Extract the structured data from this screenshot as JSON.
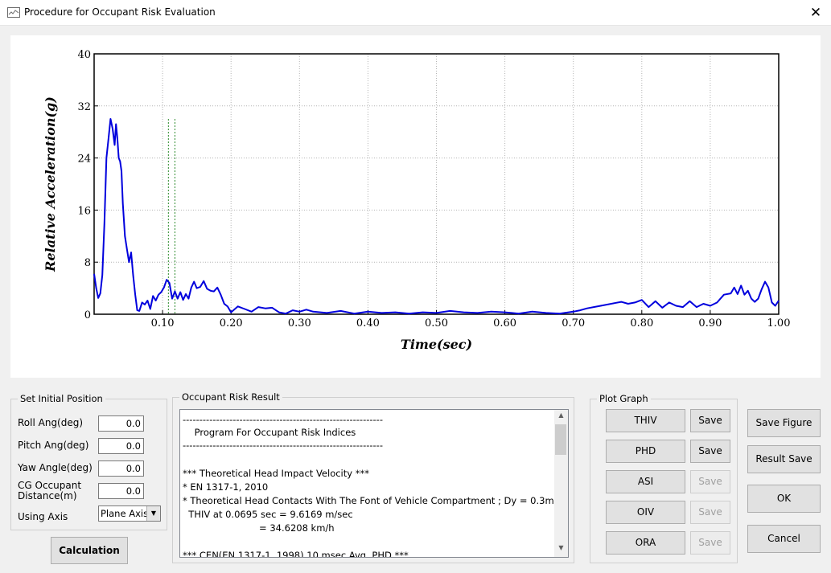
{
  "window": {
    "title": "Procedure for Occupant Risk Evaluation",
    "close_symbol": "✕"
  },
  "chart_data": {
    "type": "line",
    "xlabel": "Time(sec)",
    "ylabel": "Relative Acceleration(g)",
    "xlim": [
      0,
      1.0
    ],
    "ylim": [
      0,
      40
    ],
    "x_ticks": [
      "0.10",
      "0.20",
      "0.30",
      "0.40",
      "0.50",
      "0.60",
      "0.70",
      "0.80",
      "0.90",
      "1.00"
    ],
    "y_ticks": [
      "0",
      "8",
      "16",
      "24",
      "32",
      "40"
    ],
    "grid": true,
    "series_color": "#0000dd",
    "marker_lines_color": "#2e8b2e",
    "marker_lines_x": [
      0.1085,
      0.118
    ],
    "marker_lines_top": 30,
    "series": [
      {
        "x": [
          0,
          0.003,
          0.006,
          0.009,
          0.012,
          0.015,
          0.018,
          0.021,
          0.024,
          0.027,
          0.03,
          0.032,
          0.034,
          0.036,
          0.038,
          0.04,
          0.042,
          0.045,
          0.048,
          0.051,
          0.054,
          0.057,
          0.06,
          0.063,
          0.066,
          0.07,
          0.074,
          0.078,
          0.082,
          0.086,
          0.09,
          0.094,
          0.098,
          0.102,
          0.106,
          0.11,
          0.114,
          0.118,
          0.122,
          0.126,
          0.13,
          0.134,
          0.138,
          0.142,
          0.146,
          0.15,
          0.155,
          0.16,
          0.165,
          0.17,
          0.175,
          0.18,
          0.185,
          0.19,
          0.195,
          0.2,
          0.21,
          0.22,
          0.23,
          0.24,
          0.25,
          0.26,
          0.27,
          0.28,
          0.29,
          0.3,
          0.31,
          0.32,
          0.34,
          0.36,
          0.38,
          0.4,
          0.42,
          0.44,
          0.46,
          0.48,
          0.5,
          0.52,
          0.54,
          0.56,
          0.58,
          0.6,
          0.62,
          0.64,
          0.66,
          0.68,
          0.7,
          0.71,
          0.72,
          0.74,
          0.76,
          0.77,
          0.78,
          0.79,
          0.8,
          0.81,
          0.82,
          0.83,
          0.84,
          0.85,
          0.86,
          0.87,
          0.88,
          0.89,
          0.9,
          0.91,
          0.92,
          0.93,
          0.935,
          0.94,
          0.945,
          0.95,
          0.955,
          0.96,
          0.965,
          0.97,
          0.975,
          0.98,
          0.985,
          0.99,
          0.995,
          1.0
        ],
        "y": [
          6.2,
          4.0,
          2.5,
          3.2,
          6,
          14,
          24,
          27,
          30,
          28.5,
          26,
          29.2,
          27,
          24,
          23.5,
          22,
          17,
          12,
          10,
          8,
          9.5,
          6,
          3,
          0.6,
          0.5,
          1.8,
          1.5,
          2.1,
          0.8,
          2.8,
          2.1,
          3.0,
          3.4,
          4.1,
          5.3,
          4.8,
          2.4,
          3.5,
          2.4,
          3.4,
          2.2,
          3.1,
          2.4,
          4.1,
          5.0,
          4.0,
          4.2,
          5.1,
          3.9,
          3.6,
          3.5,
          4.1,
          3.0,
          1.6,
          1.2,
          0.3,
          1.2,
          0.8,
          0.4,
          1.1,
          0.9,
          1.0,
          0.3,
          0.1,
          0.6,
          0.4,
          0.7,
          0.4,
          0.2,
          0.5,
          0.1,
          0.4,
          0.2,
          0.3,
          0.1,
          0.3,
          0.2,
          0.5,
          0.3,
          0.2,
          0.4,
          0.3,
          0.1,
          0.4,
          0.2,
          0.1,
          0.4,
          0.6,
          0.9,
          1.3,
          1.7,
          1.9,
          1.6,
          1.8,
          2.2,
          1.1,
          2.0,
          1.0,
          1.8,
          1.3,
          1.1,
          2.0,
          1.1,
          1.6,
          1.3,
          1.8,
          3.0,
          3.2,
          4.1,
          3.1,
          4.4,
          3.0,
          3.6,
          2.4,
          1.9,
          2.4,
          3.8,
          5.0,
          4.1,
          1.8,
          1.3,
          2.1
        ]
      }
    ]
  },
  "initial_position": {
    "title": "Set Initial Position",
    "roll_label": "Roll Ang(deg)",
    "roll_value": "0.0",
    "pitch_label": "Pitch Ang(deg)",
    "pitch_value": "0.0",
    "yaw_label": "Yaw Angle(deg)",
    "yaw_value": "0.0",
    "cg_label_1": "CG  Occupant",
    "cg_label_2": "Distance(m)",
    "cg_value": "0.0",
    "axis_label": "Using Axis",
    "axis_value": "Plane Axis",
    "calc_button": "Calculation"
  },
  "occupant_risk": {
    "title": "Occupant Risk Result",
    "lines": [
      "------------------------------------------------------------",
      "    Program For Occupant Risk Indices",
      "------------------------------------------------------------",
      "",
      "*** Theoretical Head Impact Velocity ***",
      "* EN 1317-1, 2010",
      "* Theoretical Head Contacts With The Font of Vehicle Compartment ; Dy = 0.3m",
      "  THIV at 0.0695 sec = 9.6169 m/sec",
      "                          = 34.6208 km/h",
      "",
      "*** CEN(EN 1317-1, 1998) 10 msec Avg. PHD ***"
    ]
  },
  "plot_graph": {
    "title": "Plot Graph",
    "rows": [
      {
        "name": "THIV",
        "save": "Save",
        "save_enabled": true
      },
      {
        "name": "PHD",
        "save": "Save",
        "save_enabled": true
      },
      {
        "name": "ASI",
        "save": "Save",
        "save_enabled": false
      },
      {
        "name": "OIV",
        "save": "Save",
        "save_enabled": false
      },
      {
        "name": "ORA",
        "save": "Save",
        "save_enabled": false
      }
    ]
  },
  "actions": {
    "save_figure": "Save Figure",
    "result_save": "Result Save",
    "ok": "OK",
    "cancel": "Cancel"
  }
}
